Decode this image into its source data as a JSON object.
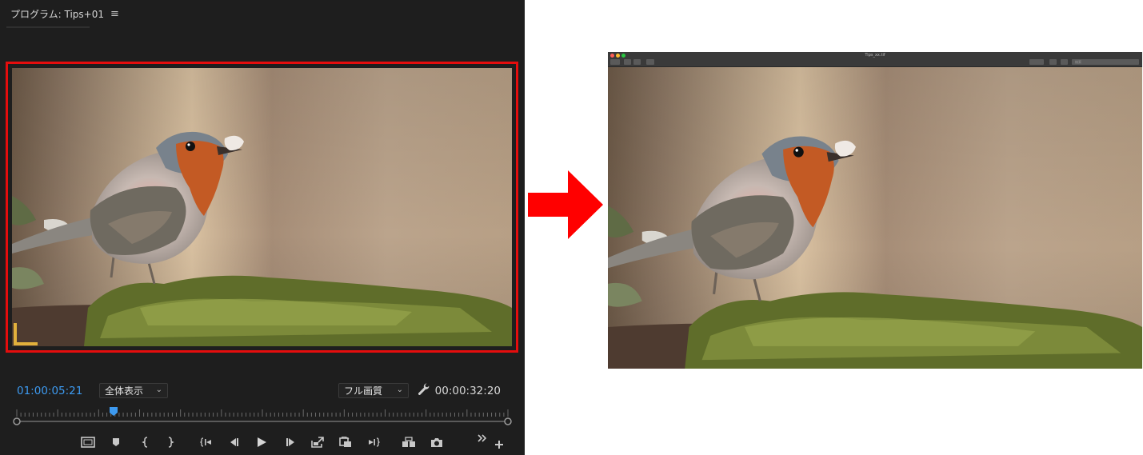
{
  "program_monitor": {
    "title": "プログラム: Tips+01",
    "menu_icon": "hamburger-menu-icon",
    "timecode_current": "01:00:05:21",
    "zoom": "全体表示",
    "quality": "フル画質",
    "timecode_duration": "00:00:32:20",
    "highlight_color": "#e40d0d",
    "accent_color": "#3d9af0",
    "transport_icons": [
      "toggle-safe-margins-icon",
      "add-marker-icon",
      "mark-in-icon",
      "mark-out-icon",
      "go-to-in-icon",
      "step-back-icon",
      "play-icon",
      "step-forward-icon",
      "lift-icon",
      "overwrite-icon",
      "go-to-out-icon",
      "comparison-view-icon",
      "export-frame-icon"
    ]
  },
  "preview_window": {
    "title": "Tips_xx.tif",
    "search_placeholder": "検索"
  },
  "arrow": {
    "color": "#ff0000",
    "icon": "right-arrow-icon"
  }
}
